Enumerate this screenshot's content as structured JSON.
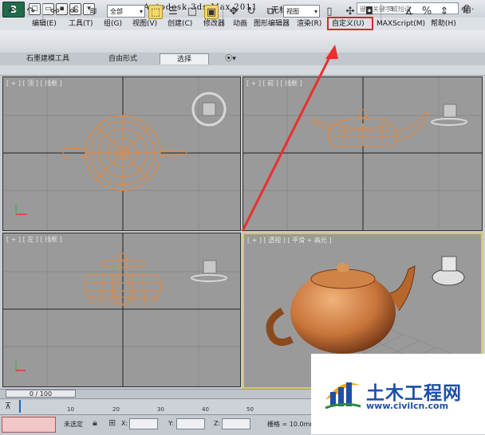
{
  "window": {
    "app_title": "Autodesk 3ds Max  2011",
    "doc_title": "无标题",
    "logo": "3ds-max-logo",
    "search_placeholder": "键入关键字或短语",
    "help_glyph": "角·"
  },
  "menu": {
    "items": [
      "编辑(E)",
      "工具(T)",
      "组(G)",
      "视图(V)",
      "创建(C)",
      "修改器",
      "动画",
      "图形编辑器",
      "渲染(R)",
      "自定义(U)",
      "MAXScript(M)",
      "帮助(H)"
    ],
    "highlighted_item": "自定义(U)",
    "highlight_color": "#d9262b"
  },
  "toolbar": {
    "selection_filter": "全部",
    "ref_coord": "视图"
  },
  "ribbon": {
    "tabs": [
      "石墨建模工具",
      "自由形式",
      "选择"
    ],
    "active_tab": "选择"
  },
  "viewports": {
    "top_label": "[ + ] [ 顶 ] [ 线框 ]",
    "front_label": "[ + ] [ 前 ] [ 线框 ]",
    "left_label": "[ + ] [ 左 ] [ 线框 ]",
    "perspective_label": "[ + ] [ 透视 ] [ 平滑 + 高光 ]",
    "active": "perspective",
    "wire_color": "#e8893a",
    "teapot_color": "#c8743a"
  },
  "timeline": {
    "frame_display": "0 / 100",
    "ticks": [
      "10",
      "20",
      "30",
      "40",
      "50"
    ]
  },
  "status": {
    "selection": "未选定",
    "x_label": "X:",
    "y_label": "Y:",
    "z_label": "Z:",
    "grid": "栅格 = 10.0mm"
  },
  "watermark": {
    "title": "土木工程网",
    "url": "www.civilcn.com",
    "color": "#1d4fa8"
  },
  "annotation": {
    "arrow_color": "#e8302e"
  }
}
